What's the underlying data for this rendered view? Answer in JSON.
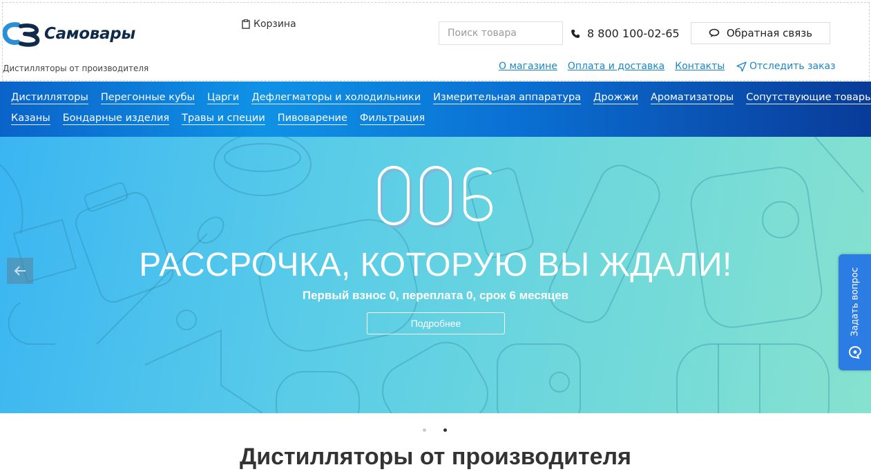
{
  "header": {
    "logo_text": "Самовары",
    "tagline": "Дистилляторы от производителя",
    "cart_label": "Корзина",
    "search_placeholder": "Поиск товара",
    "phone": "8 800 100-02-65",
    "feedback_label": "Обратная связь",
    "links": [
      "О магазине",
      "Оплата и доставка",
      "Контакты"
    ],
    "track_label": "Отследить заказ"
  },
  "nav": {
    "row1": [
      "Дистилляторы",
      "Перегонные кубы",
      "Царги",
      "Дефлегматоры и холодильники",
      "Измерительная аппаратура",
      "Дрожжи",
      "Ароматизаторы",
      "Сопутствующие товары"
    ],
    "row2": [
      "Казаны",
      "Бондарные изделия",
      "Травы и специи",
      "Пивоварение",
      "Фильтрация"
    ]
  },
  "hero": {
    "number": "006",
    "title": "РАССРОЧКА, КОТОРУЮ ВЫ ЖДАЛИ!",
    "subtitle": "Первый взнос 0, переплата 0, срок 6 месяцев",
    "button_label": "Подробнее"
  },
  "ask_widget": {
    "label": "Задать вопрос"
  },
  "slider": {
    "slide_count": 2,
    "active_index": 1
  },
  "section": {
    "title": "Дистилляторы от производителя"
  },
  "colors": {
    "accent_blue": "#1c86c8",
    "nav_start": "#0a63c9",
    "nav_end": "#093b99",
    "hero_start": "#3bb5f2",
    "hero_end": "#86e2cf",
    "ask_bg": "#2b7de3"
  }
}
